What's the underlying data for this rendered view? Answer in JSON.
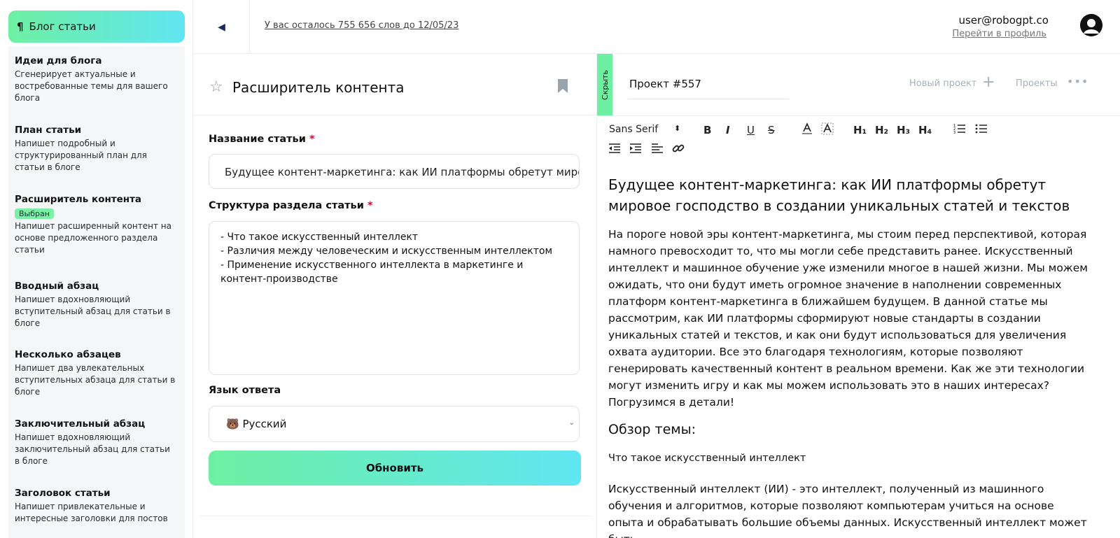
{
  "sidebar": {
    "header": {
      "icon": "pilcrow-icon",
      "glyph": "¶",
      "label": "Блог статьи"
    },
    "items": [
      {
        "title": "Идеи для блога",
        "desc": "Сгенерирует актуальные и востребованные темы для вашего блога"
      },
      {
        "title": "План статьи",
        "desc": "Напишет подробный и структурированный план для статьи в блоге"
      },
      {
        "title": "Расширитель контента",
        "badge": "Выбран",
        "desc": "Напишет расширенный контент на основе предложенного раздела статьи"
      },
      {
        "title": "Вводный абзац",
        "desc": "Напишет вдохновляющий вступительный абзац для статьи в блоге"
      },
      {
        "title": "Несколько абзацев",
        "desc": "Напишет два увлекательных вступительных абзаца для статьи в блоге"
      },
      {
        "title": "Заключительный абзац",
        "desc": "Напишет вдохновляющий заключительный абзац для статьи в блоге"
      },
      {
        "title": "Заголовок статьи",
        "desc": "Напишет привлекательные и интересные заголовки для постов"
      }
    ]
  },
  "topbar": {
    "back_icon": "triangle-left-icon",
    "words_left": "У вас осталось 755 656 слов до 12/05/23",
    "user_email": "user@robogpt.co",
    "profile_link": "Перейти в профиль"
  },
  "form": {
    "tool_title": "Расширитель контента",
    "article_title_label": "Название статьи",
    "article_title_value": "Будущее контент-маркетинга: как ИИ платформы обретут миро",
    "structure_label": "Структура раздела статьи",
    "structure_lines": [
      "- Что такое искусственный интеллект",
      "- Различия между человеческим и искусственным интеллектом",
      "- Применение искусственного интеллекта в маркетинге и контент-производстве"
    ],
    "language_label": "Язык ответа",
    "language_value": "🐻 Русский",
    "required_mark": "*",
    "update_button": "Обновить"
  },
  "editor": {
    "hide_tab": "Скрыть",
    "project_name": "Проект #557",
    "new_project": "Новый проект",
    "projects": "Проекты",
    "toolbar": {
      "font": "Sans Serif",
      "bold": "B",
      "italic": "I",
      "underline": "U",
      "strike": "S",
      "h1": "H₁",
      "h2": "H₂",
      "h3": "H₃",
      "h4": "H₄"
    },
    "doc_title": "Будущее контент-маркетинга: как ИИ платформы обретут мировое господство в создании уникальных статей и текстов",
    "doc_intro": "На пороге новой эры контент-маркетинга, мы стоим перед перспективой, которая намного превосходит то, что мы могли себе представить ранее. Искусственный интеллект и машинное обучение уже изменили многое в нашей жизни. Мы можем ожидать, что они будут иметь огромное значение в наполнении современных платформ контент-маркетинга в ближайшем будущем. В данной статье мы рассмотрим, как ИИ платформы сформируют новые стандарты в создании уникальных статей и текстов, и как они будут использоваться для увеличения охвата аудитории. Все это благодаря технологиям, которые позволяют генерировать качественный контент в реальном времени. Как же эти технологии могут изменить игру и как мы можем использовать это в наших интересах? Погрузимся в детали!",
    "doc_h2": "Обзор темы:",
    "doc_sub": "Что такое искусственный интеллект",
    "doc_para2": "Искусственный интеллект (ИИ) - это интеллект, полученный из машинного обучения и алгоритмов, которые позволяют компьютерам учиться на основе опыта и обрабатывать большие объемы данных. Искусственный интеллект может быть"
  }
}
